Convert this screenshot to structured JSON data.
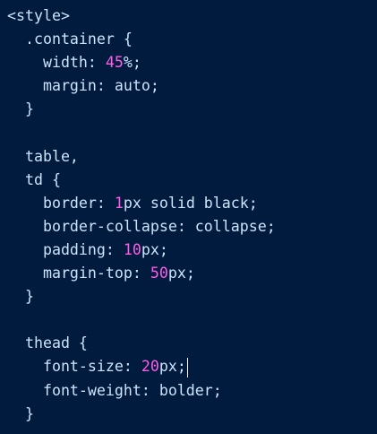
{
  "code": {
    "theme": {
      "background": "#011b3f",
      "text": "#cde3fb",
      "number": "#ff5de6"
    },
    "lines": [
      {
        "segments": [
          {
            "text": "<style>",
            "kind": "text"
          }
        ]
      },
      {
        "segments": [
          {
            "text": "  .container {",
            "kind": "text"
          }
        ]
      },
      {
        "segments": [
          {
            "text": "    width: ",
            "kind": "text"
          },
          {
            "text": "45",
            "kind": "number"
          },
          {
            "text": "%;",
            "kind": "text"
          }
        ]
      },
      {
        "segments": [
          {
            "text": "    margin: auto;",
            "kind": "text"
          }
        ]
      },
      {
        "segments": [
          {
            "text": "  }",
            "kind": "text"
          }
        ]
      },
      {
        "segments": [
          {
            "text": "",
            "kind": "text"
          }
        ]
      },
      {
        "segments": [
          {
            "text": "  table,",
            "kind": "text"
          }
        ]
      },
      {
        "segments": [
          {
            "text": "  td {",
            "kind": "text"
          }
        ]
      },
      {
        "segments": [
          {
            "text": "    border: ",
            "kind": "text"
          },
          {
            "text": "1",
            "kind": "number"
          },
          {
            "text": "px solid black;",
            "kind": "text"
          }
        ]
      },
      {
        "segments": [
          {
            "text": "    border-collapse: collapse;",
            "kind": "text"
          }
        ]
      },
      {
        "segments": [
          {
            "text": "    padding: ",
            "kind": "text"
          },
          {
            "text": "10",
            "kind": "number"
          },
          {
            "text": "px;",
            "kind": "text"
          }
        ]
      },
      {
        "segments": [
          {
            "text": "    margin-top: ",
            "kind": "text"
          },
          {
            "text": "50",
            "kind": "number"
          },
          {
            "text": "px;",
            "kind": "text"
          }
        ]
      },
      {
        "segments": [
          {
            "text": "  }",
            "kind": "text"
          }
        ]
      },
      {
        "segments": [
          {
            "text": "",
            "kind": "text"
          }
        ]
      },
      {
        "segments": [
          {
            "text": "  thead {",
            "kind": "text"
          }
        ]
      },
      {
        "segments": [
          {
            "text": "    font-size: ",
            "kind": "text"
          },
          {
            "text": "20",
            "kind": "number"
          },
          {
            "text": "px;",
            "kind": "text"
          }
        ],
        "cursor": true
      },
      {
        "segments": [
          {
            "text": "    font-weight: bolder;",
            "kind": "text"
          }
        ]
      },
      {
        "segments": [
          {
            "text": "  }",
            "kind": "text"
          }
        ]
      }
    ]
  }
}
